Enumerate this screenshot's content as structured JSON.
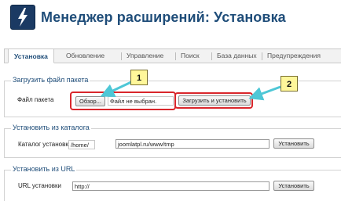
{
  "header": {
    "title": "Менеджер расширений: Установка",
    "logo_icon": "joomla-bolt-icon"
  },
  "tabs": [
    {
      "label": "Установка"
    },
    {
      "label": "Обновление"
    },
    {
      "label": "Управление"
    },
    {
      "label": "Поиск"
    },
    {
      "label": "База данных"
    },
    {
      "label": "Предупреждения"
    }
  ],
  "upload_section": {
    "legend": "Загрузить файл пакета",
    "file_label": "Файл пакета",
    "browse_button": "Обзор...",
    "file_status": "Файл не выбран.",
    "submit_button": "Загрузить и установить"
  },
  "catalog_section": {
    "legend": "Установить из каталога",
    "label": "Каталог установки",
    "prefix_value": "/home/",
    "value": "joomlatpl.ru/www/tmp",
    "button": "Установить"
  },
  "url_section": {
    "legend": "Установить из URL",
    "label": "URL установки",
    "value": "http://",
    "button": "Установить"
  },
  "annotations": {
    "callout_1": "1",
    "callout_2": "2",
    "callout_color": "#fff79a",
    "highlight_color": "#d9262b",
    "arrow_color": "#4ec7d6"
  }
}
